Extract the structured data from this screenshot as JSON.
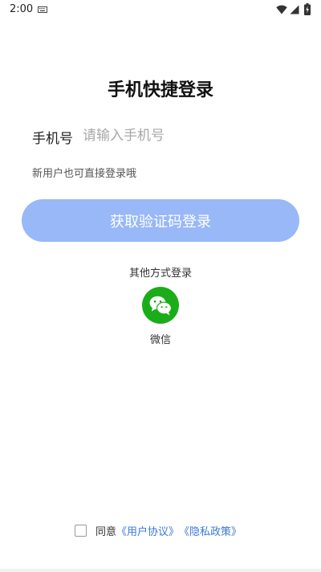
{
  "status_bar": {
    "time": "2:00"
  },
  "page": {
    "title": "手机快捷登录",
    "phone_label": "手机号",
    "phone_placeholder": "请输入手机号",
    "phone_value": "",
    "hint": "新用户也可直接登录哦",
    "login_button_label": "获取验证码登录"
  },
  "other_login": {
    "label": "其他方式登录",
    "wechat_label": "微信",
    "wechat_icon": "wechat-icon",
    "wechat_color": "#1aad19"
  },
  "agreement": {
    "checked": false,
    "prefix": "同意",
    "user_agreement": "《用户协议》",
    "privacy_policy": "《隐私政策》"
  },
  "colors": {
    "button": "#98b8f7",
    "link": "#3a78d8"
  }
}
